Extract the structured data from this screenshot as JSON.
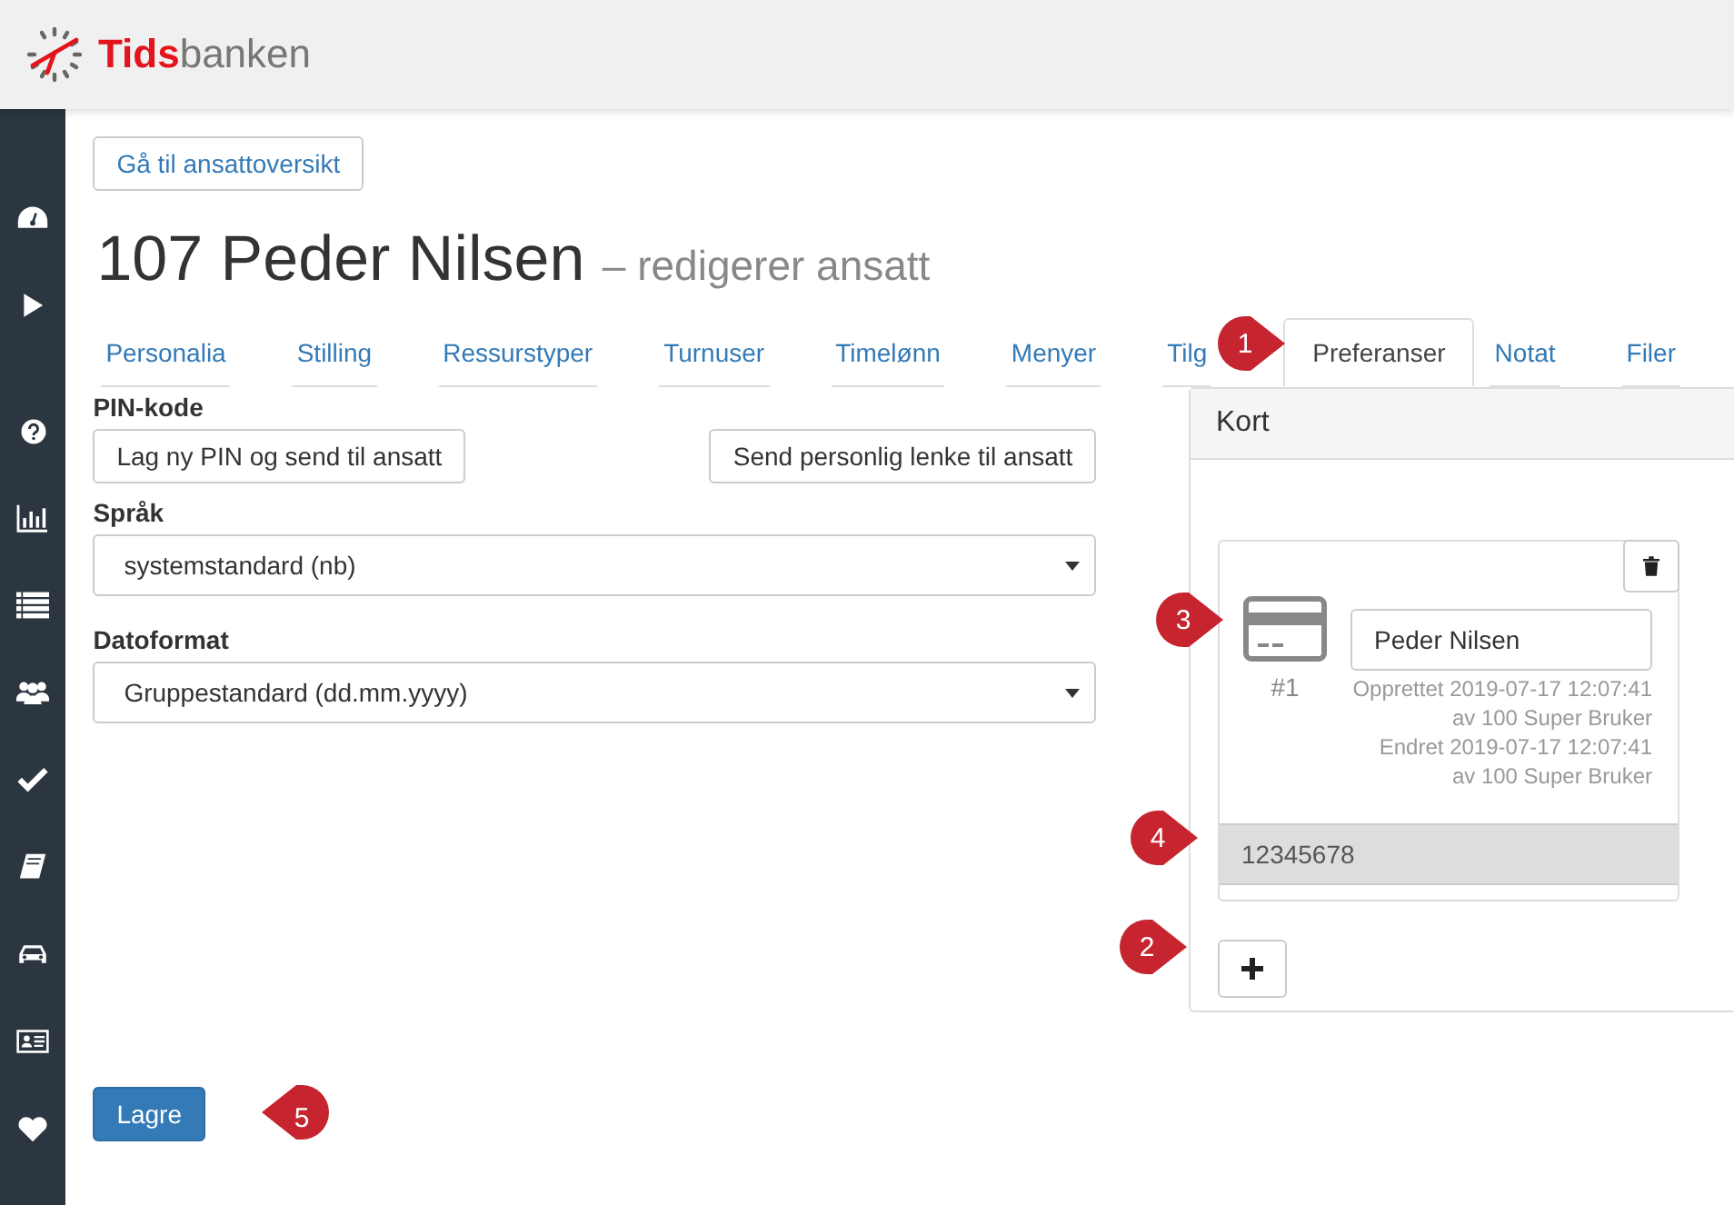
{
  "header": {
    "logo": {
      "part_1": "Tids",
      "part_2": "banken"
    }
  },
  "back_button": "Gå til ansattoversikt",
  "title": {
    "name": "107 Peder Nilsen",
    "subtitle": "– redigerer ansatt"
  },
  "tabs": [
    {
      "label": "Personalia",
      "selected": false
    },
    {
      "label": "Stilling",
      "selected": false
    },
    {
      "label": "Ressurstyper",
      "selected": false
    },
    {
      "label": "Turnuser",
      "selected": false
    },
    {
      "label": "Timelønn",
      "selected": false
    },
    {
      "label": "Menyer",
      "selected": false
    },
    {
      "label": "Tilg",
      "selected": false
    },
    {
      "label": "Preferanser",
      "selected": true
    },
    {
      "label": "Notat",
      "selected": false
    },
    {
      "label": "Filer",
      "selected": false
    }
  ],
  "pin": {
    "label": "PIN-kode",
    "buttons": [
      "Lag ny PIN og send til ansatt",
      "Send personlig lenke til ansatt"
    ]
  },
  "fields": [
    {
      "label": "Språk",
      "value": "systemstandard (nb)"
    },
    {
      "label": "Datoformat",
      "value": "Gruppestandard (dd.mm.yyyy)"
    }
  ],
  "card_panel": {
    "title": "Kort",
    "cards": [
      {
        "number": "#1",
        "name": "Peder Nilsen",
        "meta": [
          "Opprettet 2019-07-17 12:07:41",
          "av 100 Super Bruker",
          "Endret 2019-07-17 12:07:41",
          "av 100 Super Bruker"
        ],
        "card_id": "12345678"
      }
    ]
  },
  "save_button": "Lagre",
  "callouts": [
    {
      "number": "1",
      "kind": "right"
    },
    {
      "number": "2",
      "kind": "right"
    },
    {
      "number": "3",
      "kind": "right"
    },
    {
      "number": "4",
      "kind": "right"
    },
    {
      "number": "5",
      "kind": "left"
    }
  ]
}
